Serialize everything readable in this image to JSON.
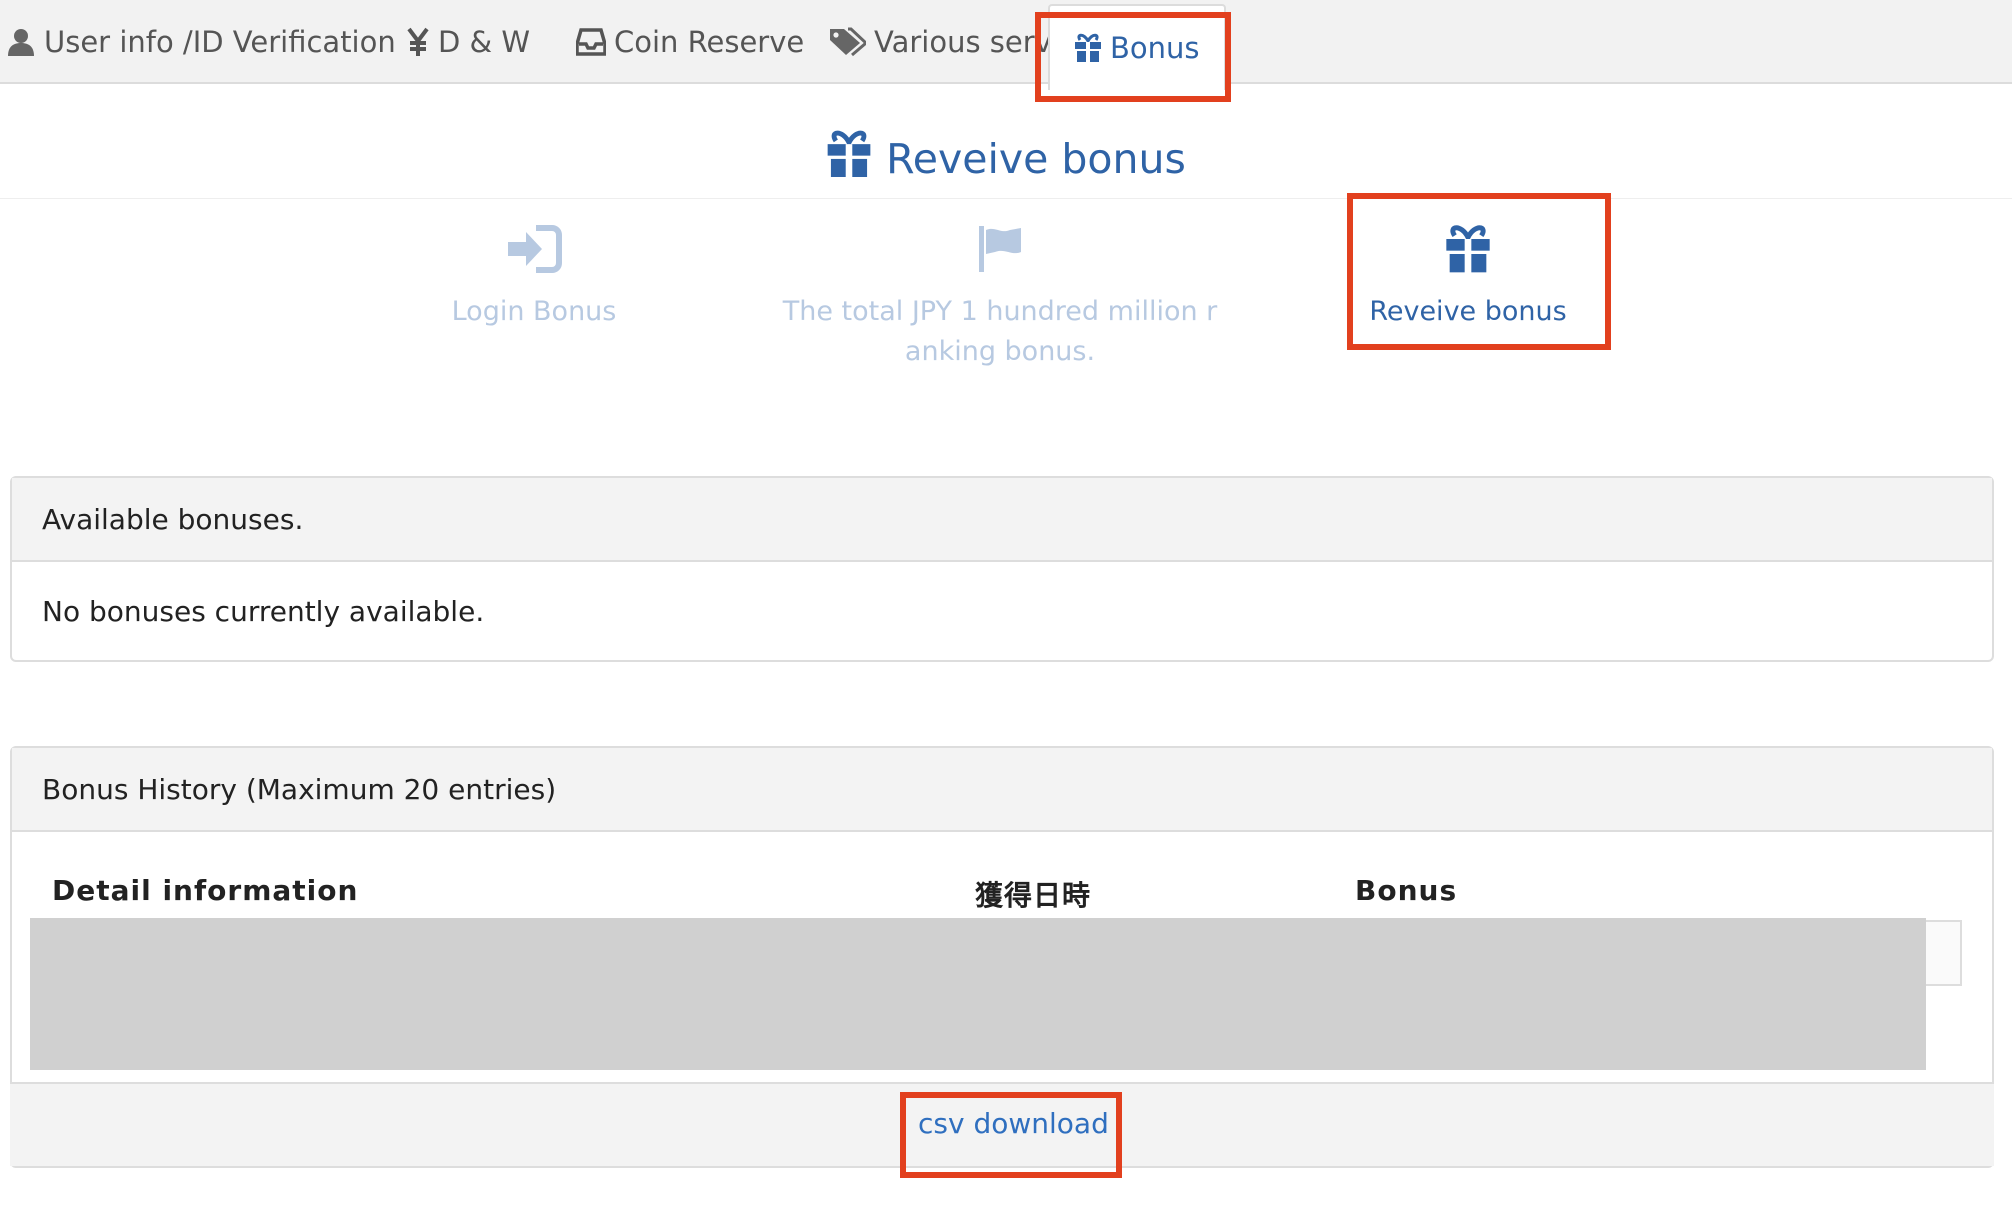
{
  "tabs": [
    {
      "label": "User info /ID Verification",
      "icon": "user-icon"
    },
    {
      "label": "D & W",
      "icon": "yen-icon"
    },
    {
      "label": "Coin Reserve",
      "icon": "inbox-icon"
    },
    {
      "label": "Various serv",
      "icon": "tags-icon"
    },
    {
      "label": "Bonus",
      "icon": "gift-icon",
      "active": true
    }
  ],
  "heading": {
    "title": "Reveive bonus",
    "icon": "gift-icon"
  },
  "subnav": [
    {
      "label": "Login Bonus",
      "icon": "sign-in-icon",
      "active": false
    },
    {
      "label_line1": "The total JPY 1 hundred million r",
      "label_line2": "anking bonus.",
      "icon": "flag-icon",
      "active": false
    },
    {
      "label": "Reveive bonus",
      "icon": "gift-icon",
      "active": true
    }
  ],
  "available": {
    "title": "Available bonuses.",
    "message": "No bonuses currently available."
  },
  "history": {
    "title": "Bonus History (Maximum 20 entries)",
    "columns": [
      "Detail information",
      "獲得日時",
      "Bonus"
    ],
    "csv_label": "csv download"
  },
  "colors": {
    "accent": "#2f63a6",
    "inactive": "#b7c9e1",
    "highlight": "#e2401e"
  }
}
